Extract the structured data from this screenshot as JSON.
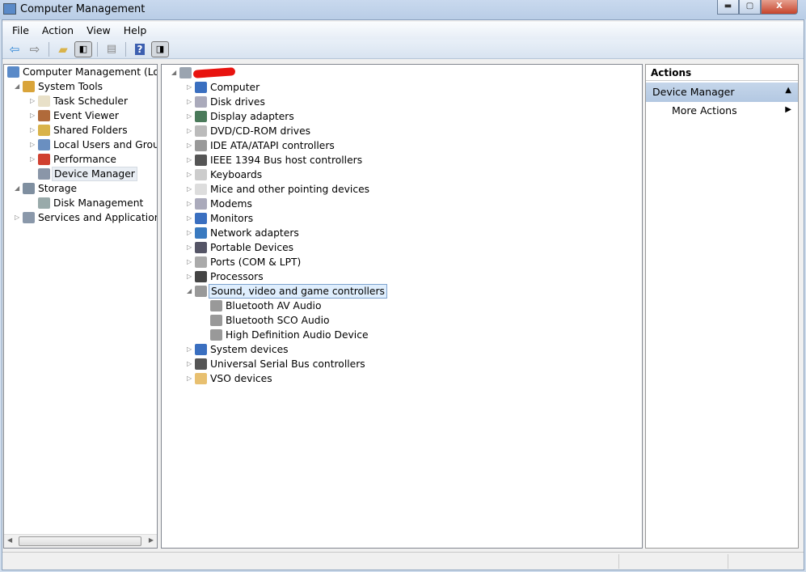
{
  "window": {
    "title": "Computer Management",
    "controls": [
      "minimize",
      "maximize",
      "close"
    ]
  },
  "menu": [
    "File",
    "Action",
    "View",
    "Help"
  ],
  "toolbar": [
    "back-icon",
    "forward-icon",
    "up-folder-icon",
    "show-hide-console-tree-icon",
    "properties-icon",
    "help-icon",
    "show-hide-action-pane-icon"
  ],
  "left_tree": [
    {
      "label": "Computer Management (Local",
      "level": 0,
      "icon": "computer-management-icon",
      "expander": ""
    },
    {
      "label": "System Tools",
      "level": 1,
      "icon": "tools-icon",
      "expander": "expanded"
    },
    {
      "label": "Task Scheduler",
      "level": 2,
      "icon": "clock-icon",
      "expander": "collapsed"
    },
    {
      "label": "Event Viewer",
      "level": 2,
      "icon": "event-viewer-icon",
      "expander": "collapsed"
    },
    {
      "label": "Shared Folders",
      "level": 2,
      "icon": "shared-folder-icon",
      "expander": "collapsed"
    },
    {
      "label": "Local Users and Groups",
      "level": 2,
      "icon": "users-icon",
      "expander": "collapsed"
    },
    {
      "label": "Performance",
      "level": 2,
      "icon": "performance-icon",
      "expander": "collapsed"
    },
    {
      "label": "Device Manager",
      "level": 2,
      "icon": "device-manager-icon",
      "expander": "",
      "selected": true
    },
    {
      "label": "Storage",
      "level": 1,
      "icon": "storage-icon",
      "expander": "expanded"
    },
    {
      "label": "Disk Management",
      "level": 2,
      "icon": "disk-icon",
      "expander": ""
    },
    {
      "label": "Services and Applications",
      "level": 1,
      "icon": "services-icon",
      "expander": "collapsed"
    }
  ],
  "device_tree": [
    {
      "label": "",
      "level": 0,
      "icon": "computer-icon",
      "expander": "expanded",
      "redacted": true
    },
    {
      "label": "Computer",
      "level": 1,
      "icon": "monitor-icon",
      "expander": "collapsed"
    },
    {
      "label": "Disk drives",
      "level": 1,
      "icon": "disk-drive-icon",
      "expander": "collapsed"
    },
    {
      "label": "Display adapters",
      "level": 1,
      "icon": "display-adapter-icon",
      "expander": "collapsed"
    },
    {
      "label": "DVD/CD-ROM drives",
      "level": 1,
      "icon": "dvd-icon",
      "expander": "collapsed"
    },
    {
      "label": "IDE ATA/ATAPI controllers",
      "level": 1,
      "icon": "ide-icon",
      "expander": "collapsed"
    },
    {
      "label": "IEEE 1394 Bus host controllers",
      "level": 1,
      "icon": "firewire-icon",
      "expander": "collapsed"
    },
    {
      "label": "Keyboards",
      "level": 1,
      "icon": "keyboard-icon",
      "expander": "collapsed"
    },
    {
      "label": "Mice and other pointing devices",
      "level": 1,
      "icon": "mouse-icon",
      "expander": "collapsed"
    },
    {
      "label": "Modems",
      "level": 1,
      "icon": "modem-icon",
      "expander": "collapsed"
    },
    {
      "label": "Monitors",
      "level": 1,
      "icon": "monitor-icon",
      "expander": "collapsed"
    },
    {
      "label": "Network adapters",
      "level": 1,
      "icon": "network-icon",
      "expander": "collapsed"
    },
    {
      "label": "Portable Devices",
      "level": 1,
      "icon": "portable-device-icon",
      "expander": "collapsed"
    },
    {
      "label": "Ports (COM & LPT)",
      "level": 1,
      "icon": "port-icon",
      "expander": "collapsed"
    },
    {
      "label": "Processors",
      "level": 1,
      "icon": "processor-icon",
      "expander": "collapsed"
    },
    {
      "label": "Sound, video and game controllers",
      "level": 1,
      "icon": "speaker-icon",
      "expander": "expanded",
      "focused": true
    },
    {
      "label": "Bluetooth AV Audio",
      "level": 2,
      "icon": "speaker-icon",
      "expander": ""
    },
    {
      "label": "Bluetooth SCO Audio",
      "level": 2,
      "icon": "speaker-icon",
      "expander": ""
    },
    {
      "label": "High Definition Audio Device",
      "level": 2,
      "icon": "speaker-icon",
      "expander": ""
    },
    {
      "label": "System devices",
      "level": 1,
      "icon": "system-device-icon",
      "expander": "collapsed"
    },
    {
      "label": "Universal Serial Bus controllers",
      "level": 1,
      "icon": "usb-icon",
      "expander": "collapsed"
    },
    {
      "label": "VSO devices",
      "level": 1,
      "icon": "vso-icon",
      "expander": "collapsed"
    }
  ],
  "actions": {
    "header": "Actions",
    "section": "Device Manager",
    "item": "More Actions"
  }
}
